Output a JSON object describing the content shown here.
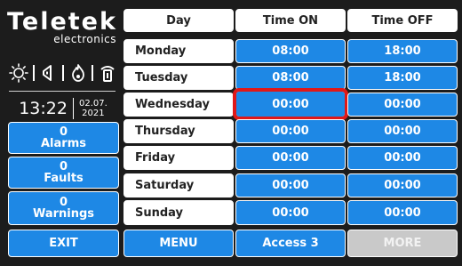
{
  "brand": {
    "name": "Teletek",
    "subtitle": "electronics"
  },
  "status_icons": [
    "sun-icon",
    "speaker-icon",
    "flame-icon",
    "detector-icon"
  ],
  "clock": {
    "time": "13:22",
    "date_line1": "02.07.",
    "date_line2": "2021"
  },
  "counters": [
    {
      "count": "0",
      "label": "Alarms"
    },
    {
      "count": "0",
      "label": "Faults"
    },
    {
      "count": "0",
      "label": "Warnings"
    }
  ],
  "table": {
    "headers": {
      "day": "Day",
      "on": "Time ON",
      "off": "Time OFF"
    },
    "rows": [
      {
        "day": "Monday",
        "on": "08:00",
        "off": "18:00"
      },
      {
        "day": "Tuesday",
        "on": "08:00",
        "off": "18:00"
      },
      {
        "day": "Wednesday",
        "on": "00:00",
        "off": "00:00"
      },
      {
        "day": "Thursday",
        "on": "00:00",
        "off": "00:00"
      },
      {
        "day": "Friday",
        "on": "00:00",
        "off": "00:00"
      },
      {
        "day": "Saturday",
        "on": "00:00",
        "off": "00:00"
      },
      {
        "day": "Sunday",
        "on": "00:00",
        "off": "00:00"
      }
    ],
    "selected": {
      "row": "Wednesday",
      "column": "Time ON"
    }
  },
  "bottom": {
    "exit": "EXIT",
    "menu": "MENU",
    "access": "Access 3",
    "more": "MORE"
  },
  "colors": {
    "accent": "#1e88e5",
    "background": "#1c1c1c",
    "selection": "#e01818",
    "disabled": "#c9c9c9"
  }
}
